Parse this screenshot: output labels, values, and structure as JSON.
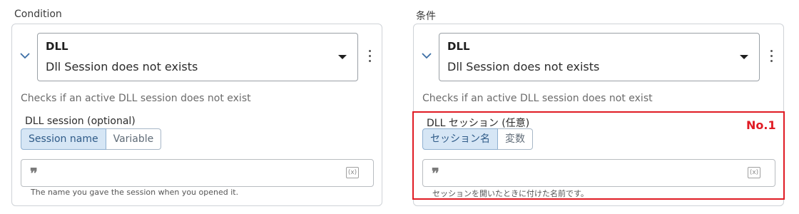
{
  "left": {
    "heading": "Condition",
    "dropdown": {
      "type": "DLL",
      "value": "Dll Session does not exists"
    },
    "description": "Checks if an active DLL session does not exist",
    "field_label": "DLL session (optional)",
    "toggle": {
      "option1": "Session name",
      "option2": "Variable"
    },
    "input": {
      "value": "",
      "variable_button": "(x)"
    },
    "hint": "The name you gave the session when you opened it."
  },
  "right": {
    "heading": "条件",
    "dropdown": {
      "type": "DLL",
      "value": "Dll Session does not exists"
    },
    "description": "Checks if an active DLL session does not exist",
    "field_label": "DLL セッション (任意)",
    "toggle": {
      "option1": "セッション名",
      "option2": "変数"
    },
    "input": {
      "value": "",
      "variable_button": "(x)"
    },
    "hint": "セッションを開いたときに付けた名前です。"
  },
  "annotation": {
    "label": "No.1",
    "color": "#e01b24"
  },
  "colors": {
    "selected_bg": "#d6e6f5",
    "selected_text": "#2f5b88"
  },
  "icons": {
    "expand": "chevron-down-icon",
    "menu": "more-vertical-icon",
    "text": "quote-icon",
    "variable": "variable-icon"
  }
}
